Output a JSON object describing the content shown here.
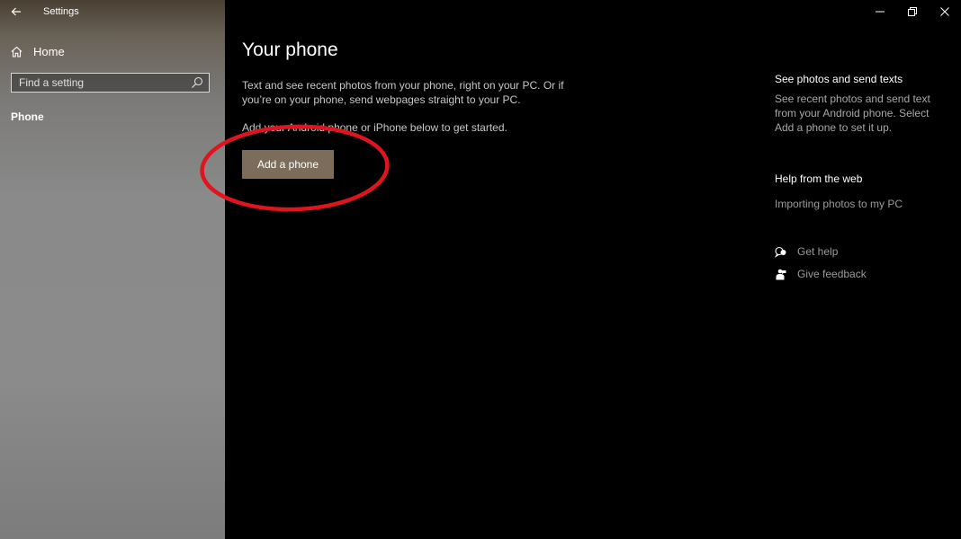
{
  "window": {
    "title": "Settings"
  },
  "sidebar": {
    "home_label": "Home",
    "search_placeholder": "Find a setting",
    "active_item": "Phone"
  },
  "main": {
    "title": "Your phone",
    "description": "Text and see recent photos from your phone, right on your PC. Or if you’re on your phone, send webpages straight to your PC.",
    "instruction": "Add your Android phone or iPhone below to get started.",
    "add_phone_button": "Add a phone"
  },
  "right_panel": {
    "section1_heading": "See photos and send texts",
    "section1_text": "See recent photos and send text from your Android phone. Select Add a phone to set it up.",
    "section2_heading": "Help from the web",
    "web_link": "Importing photos to my PC",
    "get_help": "Get help",
    "give_feedback": "Give feedback"
  },
  "colors": {
    "accent_button": "#7b6d5a",
    "annotation": "#e0141e",
    "background": "#000000"
  },
  "icons": {
    "back": "back-arrow-icon",
    "home": "home-icon",
    "search": "search-icon",
    "minimize": "minimize-icon",
    "restore": "restore-icon",
    "close": "close-icon",
    "help": "help-chat-icon",
    "feedback": "feedback-icon"
  }
}
